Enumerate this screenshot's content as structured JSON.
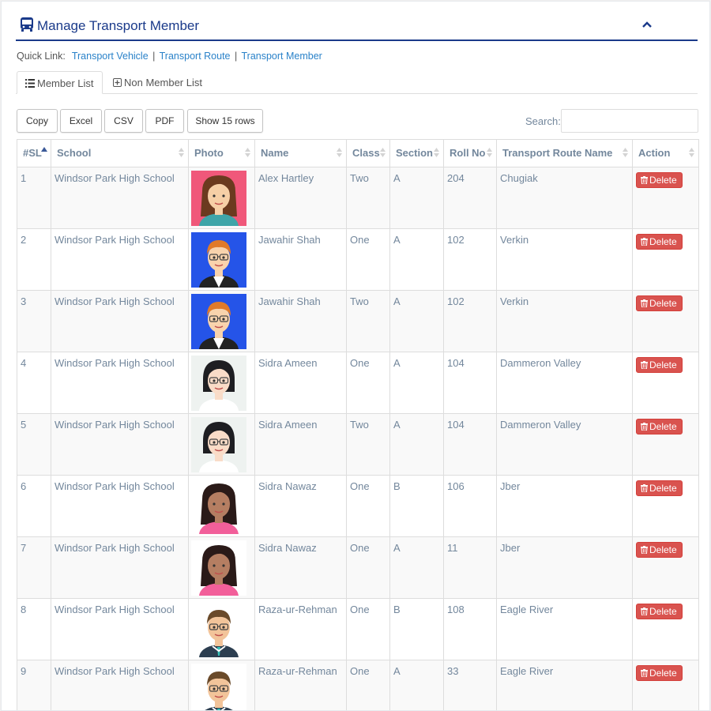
{
  "header": {
    "title": "Manage Transport Member"
  },
  "quick_links": {
    "label": "Quick Link:",
    "links": [
      "Transport Vehicle",
      "Transport Route",
      "Transport Member"
    ],
    "separator": "|"
  },
  "tabs": [
    {
      "label": "Member List",
      "active": true
    },
    {
      "label": "Non Member List",
      "active": false
    }
  ],
  "export_buttons": [
    "Copy",
    "Excel",
    "CSV",
    "PDF",
    "Show 15 rows"
  ],
  "search": {
    "label": "Search:",
    "value": ""
  },
  "table": {
    "columns": [
      "#SL",
      "School",
      "Photo",
      "Name",
      "Class",
      "Section",
      "Roll No",
      "Transport Route Name",
      "Action"
    ],
    "action_label": "Delete",
    "rows": [
      {
        "sl": "1",
        "school": "Windsor Park High School",
        "photo": "avatar-girl-brown-hair",
        "name": "Alex Hartley",
        "class": "Two",
        "section": "A",
        "roll": "204",
        "route": "Chugiak"
      },
      {
        "sl": "2",
        "school": "Windsor Park High School",
        "photo": "avatar-boy-glasses-orange-hair",
        "name": "Jawahir Shah",
        "class": "One",
        "section": "A",
        "roll": "102",
        "route": "Verkin"
      },
      {
        "sl": "3",
        "school": "Windsor Park High School",
        "photo": "avatar-boy-glasses-orange-hair",
        "name": "Jawahir Shah",
        "class": "Two",
        "section": "A",
        "roll": "102",
        "route": "Verkin"
      },
      {
        "sl": "4",
        "school": "Windsor Park High School",
        "photo": "avatar-woman-glasses-short-hair",
        "name": "Sidra Ameen",
        "class": "One",
        "section": "A",
        "roll": "104",
        "route": "Dammeron Valley"
      },
      {
        "sl": "5",
        "school": "Windsor Park High School",
        "photo": "avatar-woman-glasses-short-hair",
        "name": "Sidra Ameen",
        "class": "Two",
        "section": "A",
        "roll": "104",
        "route": "Dammeron Valley"
      },
      {
        "sl": "6",
        "school": "Windsor Park High School",
        "photo": "avatar-woman-long-hair-pink",
        "name": "Sidra Nawaz",
        "class": "One",
        "section": "B",
        "roll": "106",
        "route": "Jber"
      },
      {
        "sl": "7",
        "school": "Windsor Park High School",
        "photo": "avatar-woman-long-hair-pink",
        "name": "Sidra Nawaz",
        "class": "One",
        "section": "A",
        "roll": "11",
        "route": "Jber"
      },
      {
        "sl": "8",
        "school": "Windsor Park High School",
        "photo": "avatar-man-glasses-suit",
        "name": "Raza-ur-Rehman",
        "class": "One",
        "section": "B",
        "roll": "108",
        "route": "Eagle River"
      },
      {
        "sl": "9",
        "school": "Windsor Park High School",
        "photo": "avatar-man-glasses-suit",
        "name": "Raza-ur-Rehman",
        "class": "One",
        "section": "A",
        "roll": "33",
        "route": "Eagle River"
      }
    ]
  },
  "colors": {
    "accent": "#1a3a8a",
    "link": "#2a82c9",
    "danger": "#d9534f",
    "text": "#73879c"
  }
}
